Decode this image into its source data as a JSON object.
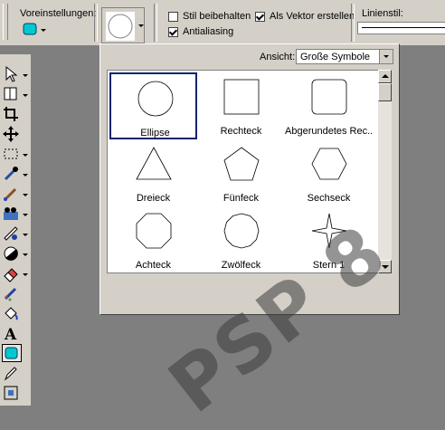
{
  "toolbar": {
    "presets_label": "Voreinstellungen:",
    "retain_style_label": "Stil beibehalten",
    "retain_style_checked": false,
    "create_vector_label": "Als Vektor erstellen",
    "create_vector_checked": true,
    "antialias_label": "Antialiasing",
    "antialias_checked": true,
    "line_style_label": "Linienstil:"
  },
  "picker": {
    "view_label": "Ansicht:",
    "view_value": "Große Symbole",
    "shapes": [
      {
        "label": "Ellipse",
        "icon": "ellipse-icon",
        "selected": true
      },
      {
        "label": "Rechteck",
        "icon": "rectangle-icon",
        "selected": false
      },
      {
        "label": "Abgerundetes Rec...",
        "icon": "rounded-rectangle-icon",
        "selected": false
      },
      {
        "label": "Dreieck",
        "icon": "triangle-icon",
        "selected": false
      },
      {
        "label": "Fünfeck",
        "icon": "pentagon-icon",
        "selected": false
      },
      {
        "label": "Sechseck",
        "icon": "hexagon-icon",
        "selected": false
      },
      {
        "label": "Achteck",
        "icon": "octagon-icon",
        "selected": false
      },
      {
        "label": "Zwölfeck",
        "icon": "dodecagon-icon",
        "selected": false
      },
      {
        "label": "Stern 1",
        "icon": "star-icon",
        "selected": false
      }
    ]
  },
  "watermark": "PSP 8",
  "colors": {
    "accent": "#00c0c0",
    "selection": "#0a246a"
  }
}
